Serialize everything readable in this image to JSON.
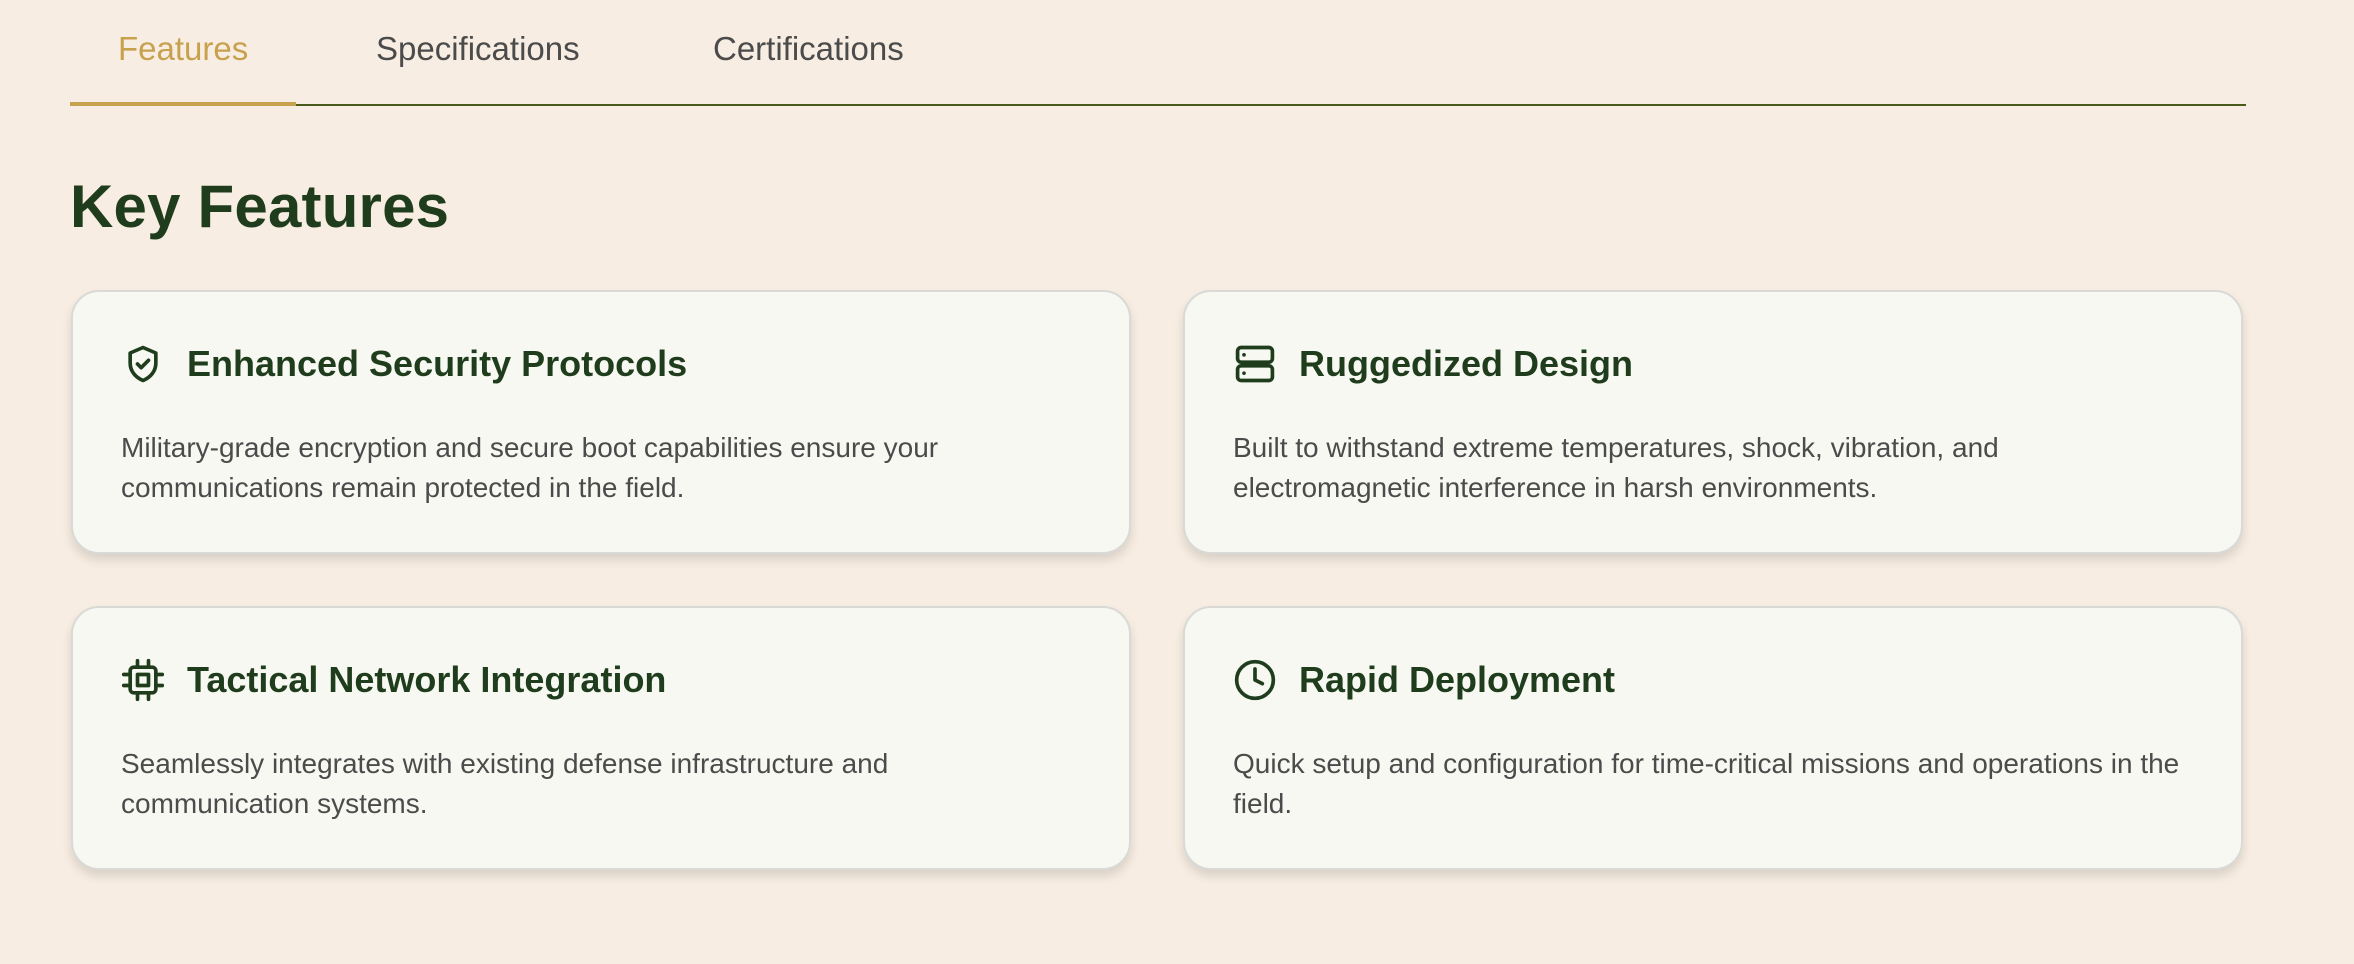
{
  "tabs": [
    {
      "label": "Features",
      "active": true
    },
    {
      "label": "Specifications",
      "active": false
    },
    {
      "label": "Certifications",
      "active": false
    }
  ],
  "page_title": "Key Features",
  "colors": {
    "background": "#f7ede2",
    "accent": "#c8a14f",
    "heading": "#1f3d1c",
    "body_text": "#4b4b4b",
    "card_bg": "#f8f8f3"
  },
  "cards": [
    {
      "icon": "shield-check-icon",
      "title": "Enhanced Security Protocols",
      "description": "Military-grade encryption and secure boot capabilities ensure your communications remain protected in the field."
    },
    {
      "icon": "server-icon",
      "title": "Ruggedized Design",
      "description": "Built to withstand extreme temperatures, shock, vibration, and electromagnetic interference in harsh environments."
    },
    {
      "icon": "chip-icon",
      "title": "Tactical Network Integration",
      "description": "Seamlessly integrates with existing defense infrastructure and communication systems."
    },
    {
      "icon": "clock-icon",
      "title": "Rapid Deployment",
      "description": "Quick setup and configuration for time-critical missions and operations in the field."
    }
  ]
}
